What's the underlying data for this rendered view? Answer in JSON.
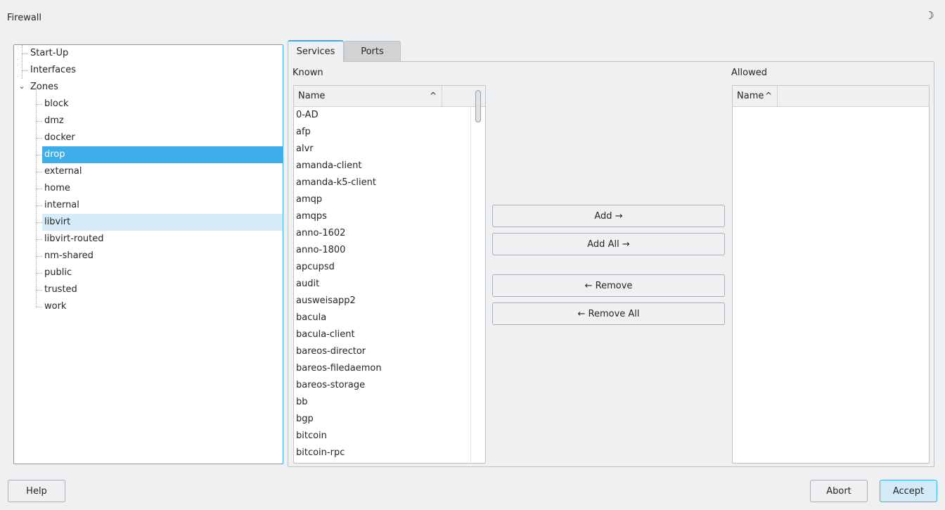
{
  "window": {
    "title": "Firewall",
    "theme_icon": "moon-icon"
  },
  "tree": {
    "items": [
      {
        "label": "Start-Up"
      },
      {
        "label": "Interfaces"
      },
      {
        "label": "Zones"
      }
    ],
    "zones": [
      {
        "label": "block"
      },
      {
        "label": "dmz"
      },
      {
        "label": "docker"
      },
      {
        "label": "drop"
      },
      {
        "label": "external"
      },
      {
        "label": "home"
      },
      {
        "label": "internal"
      },
      {
        "label": "libvirt"
      },
      {
        "label": "libvirt-routed"
      },
      {
        "label": "nm-shared"
      },
      {
        "label": "public"
      },
      {
        "label": "trusted"
      },
      {
        "label": "work"
      }
    ],
    "selected": "drop",
    "hovered": "libvirt"
  },
  "tabs": [
    {
      "label": "Services",
      "active": true
    },
    {
      "label": "Ports",
      "active": false
    }
  ],
  "known": {
    "label": "Known",
    "column": "Name",
    "items": [
      "0-AD",
      "afp",
      "alvr",
      "amanda-client",
      "amanda-k5-client",
      "amqp",
      "amqps",
      "anno-1602",
      "anno-1800",
      "apcupsd",
      "audit",
      "ausweisapp2",
      "bacula",
      "bacula-client",
      "bareos-director",
      "bareos-filedaemon",
      "bareos-storage",
      "bb",
      "bgp",
      "bitcoin",
      "bitcoin-rpc"
    ]
  },
  "allowed": {
    "label": "Allowed",
    "column": "Name"
  },
  "actions": {
    "add": "Add →",
    "add_all": "Add All →",
    "remove": "← Remove",
    "remove_all": "← Remove All"
  },
  "footer": {
    "help": "Help",
    "abort": "Abort",
    "accept": "Accept"
  },
  "colors": {
    "accent": "#3daee9",
    "selection": "#3daee9",
    "hover": "#d6ecf8",
    "background": "#eff0f1"
  }
}
